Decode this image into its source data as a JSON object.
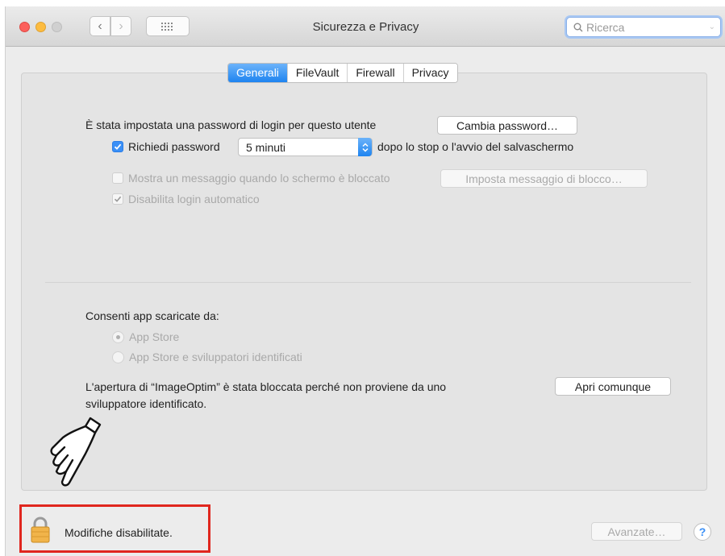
{
  "window": {
    "title": "Sicurezza e Privacy",
    "search_placeholder": "Ricerca"
  },
  "tabs": [
    {
      "label": "Generali",
      "active": true
    },
    {
      "label": "FileVault",
      "active": false
    },
    {
      "label": "Firewall",
      "active": false
    },
    {
      "label": "Privacy",
      "active": false
    }
  ],
  "general": {
    "password_text": "È stata impostata una password di login per questo utente",
    "change_password_button": "Cambia password…",
    "require_password_label": "Richiedi password",
    "require_password_checked": true,
    "require_password_delay": "5 minuti",
    "require_password_suffix": "dopo lo stop o l'avvio del salvaschermo",
    "show_message_label": "Mostra un messaggio quando lo schermo è bloccato",
    "show_message_checked": false,
    "set_message_button": "Imposta messaggio di blocco…",
    "disable_autologin_label": "Disabilita login automatico",
    "disable_autologin_checked": true
  },
  "apps": {
    "allow_label": "Consenti app scaricate da:",
    "options": [
      {
        "label": "App Store",
        "selected": true
      },
      {
        "label": "App Store e sviluppatori identificati",
        "selected": false
      }
    ],
    "blocked_message_line1": "L'apertura di “ImageOptim” è stata bloccata perché non proviene da uno",
    "blocked_message_line2": "sviluppatore identificato.",
    "open_anyway_button": "Apri comunque"
  },
  "footer": {
    "lock_text": "Modifiche disabilitate.",
    "advanced_button": "Avanzate…",
    "help_button": "?"
  },
  "icons": {
    "lock": "lock-icon",
    "hand": "pointing-hand-icon",
    "search": "search-icon",
    "grid": "grid-icon"
  },
  "colors": {
    "accent": "#1e84f0",
    "highlight_box": "#e0261e"
  }
}
